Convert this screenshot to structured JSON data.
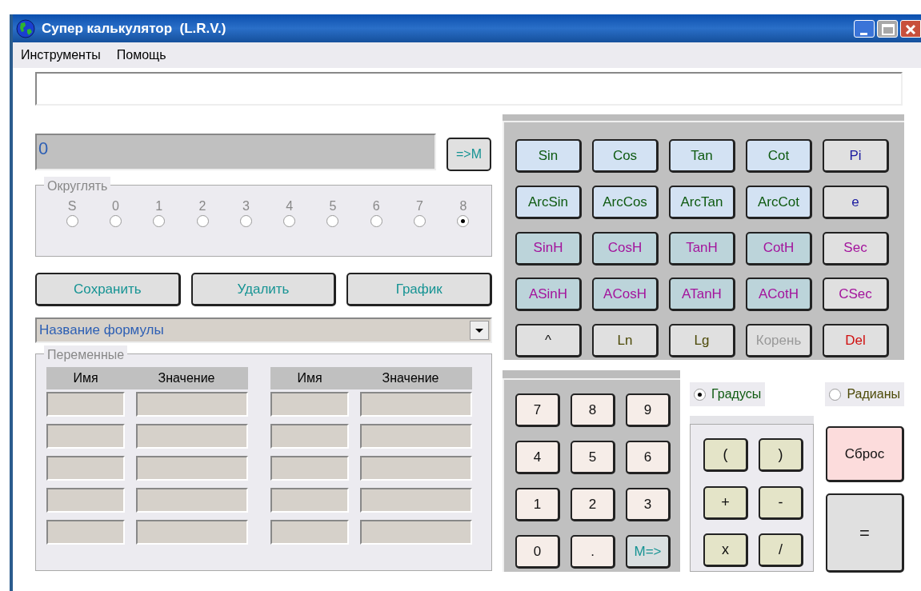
{
  "window": {
    "title": "Супер калькулятор  (L.R.V.)",
    "controls": [
      {
        "kind": "minimize",
        "disabled": false
      },
      {
        "kind": "maximize",
        "disabled": true
      },
      {
        "kind": "close",
        "disabled": false
      }
    ]
  },
  "menu": [
    "Инструменты",
    "Помощь"
  ],
  "display": {
    "value": "0"
  },
  "memory_store_button": "=>M",
  "rounding": {
    "title": "Округлять",
    "options": [
      {
        "label": "S",
        "selected": false
      },
      {
        "label": "0",
        "selected": false
      },
      {
        "label": "1",
        "selected": false
      },
      {
        "label": "2",
        "selected": false
      },
      {
        "label": "3",
        "selected": false
      },
      {
        "label": "4",
        "selected": false
      },
      {
        "label": "5",
        "selected": false
      },
      {
        "label": "6",
        "selected": false
      },
      {
        "label": "7",
        "selected": false
      },
      {
        "label": "8",
        "selected": true
      }
    ]
  },
  "action_buttons": [
    "Сохранить",
    "Удалить",
    "График"
  ],
  "formula_select": {
    "value": "Название формулы"
  },
  "variables": {
    "title": "Переменные",
    "tables": [
      {
        "columns": [
          "Имя",
          "Значение"
        ],
        "rows": [
          {},
          {},
          {},
          {},
          {}
        ]
      },
      {
        "columns": [
          "Имя",
          "Значение"
        ],
        "rows": [
          {},
          {},
          {},
          {},
          {}
        ]
      }
    ]
  },
  "function_buttons": [
    {
      "label": "Sin",
      "kind": "trig",
      "disabled": false
    },
    {
      "label": "Cos",
      "kind": "trig",
      "disabled": false
    },
    {
      "label": "Tan",
      "kind": "trig",
      "disabled": false
    },
    {
      "label": "Cot",
      "kind": "trig",
      "disabled": false
    },
    {
      "label": "Pi",
      "kind": "constant",
      "disabled": false
    },
    {
      "label": "ArcSin",
      "kind": "trig",
      "disabled": false
    },
    {
      "label": "ArcCos",
      "kind": "trig",
      "disabled": false
    },
    {
      "label": "ArcTan",
      "kind": "trig",
      "disabled": false
    },
    {
      "label": "ArcCot",
      "kind": "trig",
      "disabled": false
    },
    {
      "label": "e",
      "kind": "constant",
      "disabled": false
    },
    {
      "label": "SinH",
      "kind": "hyperbolic",
      "disabled": false
    },
    {
      "label": "CosH",
      "kind": "hyperbolic",
      "disabled": false
    },
    {
      "label": "TanH",
      "kind": "hyperbolic",
      "disabled": false
    },
    {
      "label": "CotH",
      "kind": "hyperbolic",
      "disabled": false
    },
    {
      "label": "Sec",
      "kind": "secant",
      "disabled": false
    },
    {
      "label": "ASinH",
      "kind": "hyperbolic",
      "disabled": false
    },
    {
      "label": "ACosH",
      "kind": "hyperbolic",
      "disabled": false
    },
    {
      "label": "ATanH",
      "kind": "hyperbolic",
      "disabled": false
    },
    {
      "label": "ACotH",
      "kind": "hyperbolic",
      "disabled": false
    },
    {
      "label": "CSec",
      "kind": "secant",
      "disabled": false
    },
    {
      "label": "^",
      "kind": "power",
      "disabled": false
    },
    {
      "label": "Ln",
      "kind": "log",
      "disabled": false
    },
    {
      "label": "Lg",
      "kind": "log",
      "disabled": false
    },
    {
      "label": "Корень",
      "kind": "power",
      "disabled": true
    },
    {
      "label": "Del",
      "kind": "delete",
      "disabled": false
    }
  ],
  "numpad": [
    {
      "label": "7",
      "kind": "digit"
    },
    {
      "label": "8",
      "kind": "digit"
    },
    {
      "label": "9",
      "kind": "digit"
    },
    {
      "label": "4",
      "kind": "digit"
    },
    {
      "label": "5",
      "kind": "digit"
    },
    {
      "label": "6",
      "kind": "digit"
    },
    {
      "label": "1",
      "kind": "digit"
    },
    {
      "label": "2",
      "kind": "digit"
    },
    {
      "label": "3",
      "kind": "digit"
    },
    {
      "label": "0",
      "kind": "digit"
    },
    {
      "label": ".",
      "kind": "digit"
    },
    {
      "label": "M=>",
      "kind": "memory"
    }
  ],
  "angle_units": [
    {
      "label": "Градусы",
      "selected": true
    },
    {
      "label": "Радианы",
      "selected": false
    }
  ],
  "operators": [
    "(",
    ")",
    "+",
    "-",
    "x",
    "/"
  ],
  "reset_button": "Сброс",
  "equals_button": "="
}
